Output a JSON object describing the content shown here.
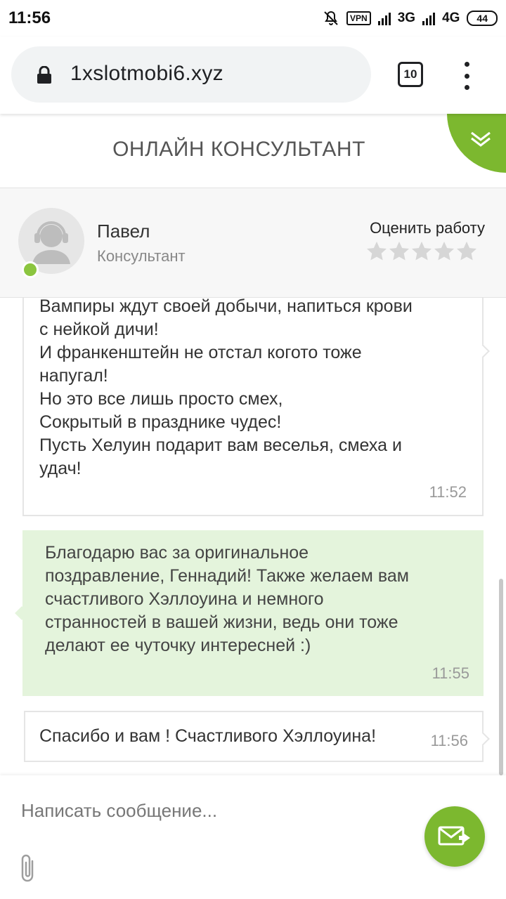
{
  "status_bar": {
    "time": "11:56",
    "vpn": "VPN",
    "network_1": "3G",
    "network_2": "4G",
    "battery": "44"
  },
  "browser": {
    "url": "1xslotmobi6.xyz",
    "tab_count": "10"
  },
  "chat": {
    "title": "ОНЛАЙН КОНСУЛЬТАНТ",
    "accent_color": "#7cb82f"
  },
  "consultant": {
    "name": "Павел",
    "role": "Консультант",
    "rate_label": "Оценить работу",
    "rating_stars": 5,
    "rating_value": 0,
    "online": true
  },
  "messages": [
    {
      "direction": "incoming",
      "text": "Вампиры ждут своей добычи, напиться крови\nс нейкой дичи!\nИ франкенштейн не отстал когото тоже\nнапугал!\nНо это все лишь просто смех,\nСокрытый в празднике чудес!\nПусть Хелуин подарит вам веселья, смеха и\nудач!",
      "time": "11:52"
    },
    {
      "direction": "outgoing",
      "text": "Благодарю вас за оригинальное\nпоздравление, Геннадий! Также желаем вам\nсчастливого Хэллоуина и немного\nстранностей в вашей жизни, ведь они тоже\nделают ее чуточку интересней :)",
      "time": "11:55"
    },
    {
      "direction": "incoming",
      "text": "Спасибо и вам ! Счастливого Хэллоуина!",
      "time": "11:56"
    }
  ],
  "composer": {
    "placeholder": "Написать сообщение..."
  }
}
